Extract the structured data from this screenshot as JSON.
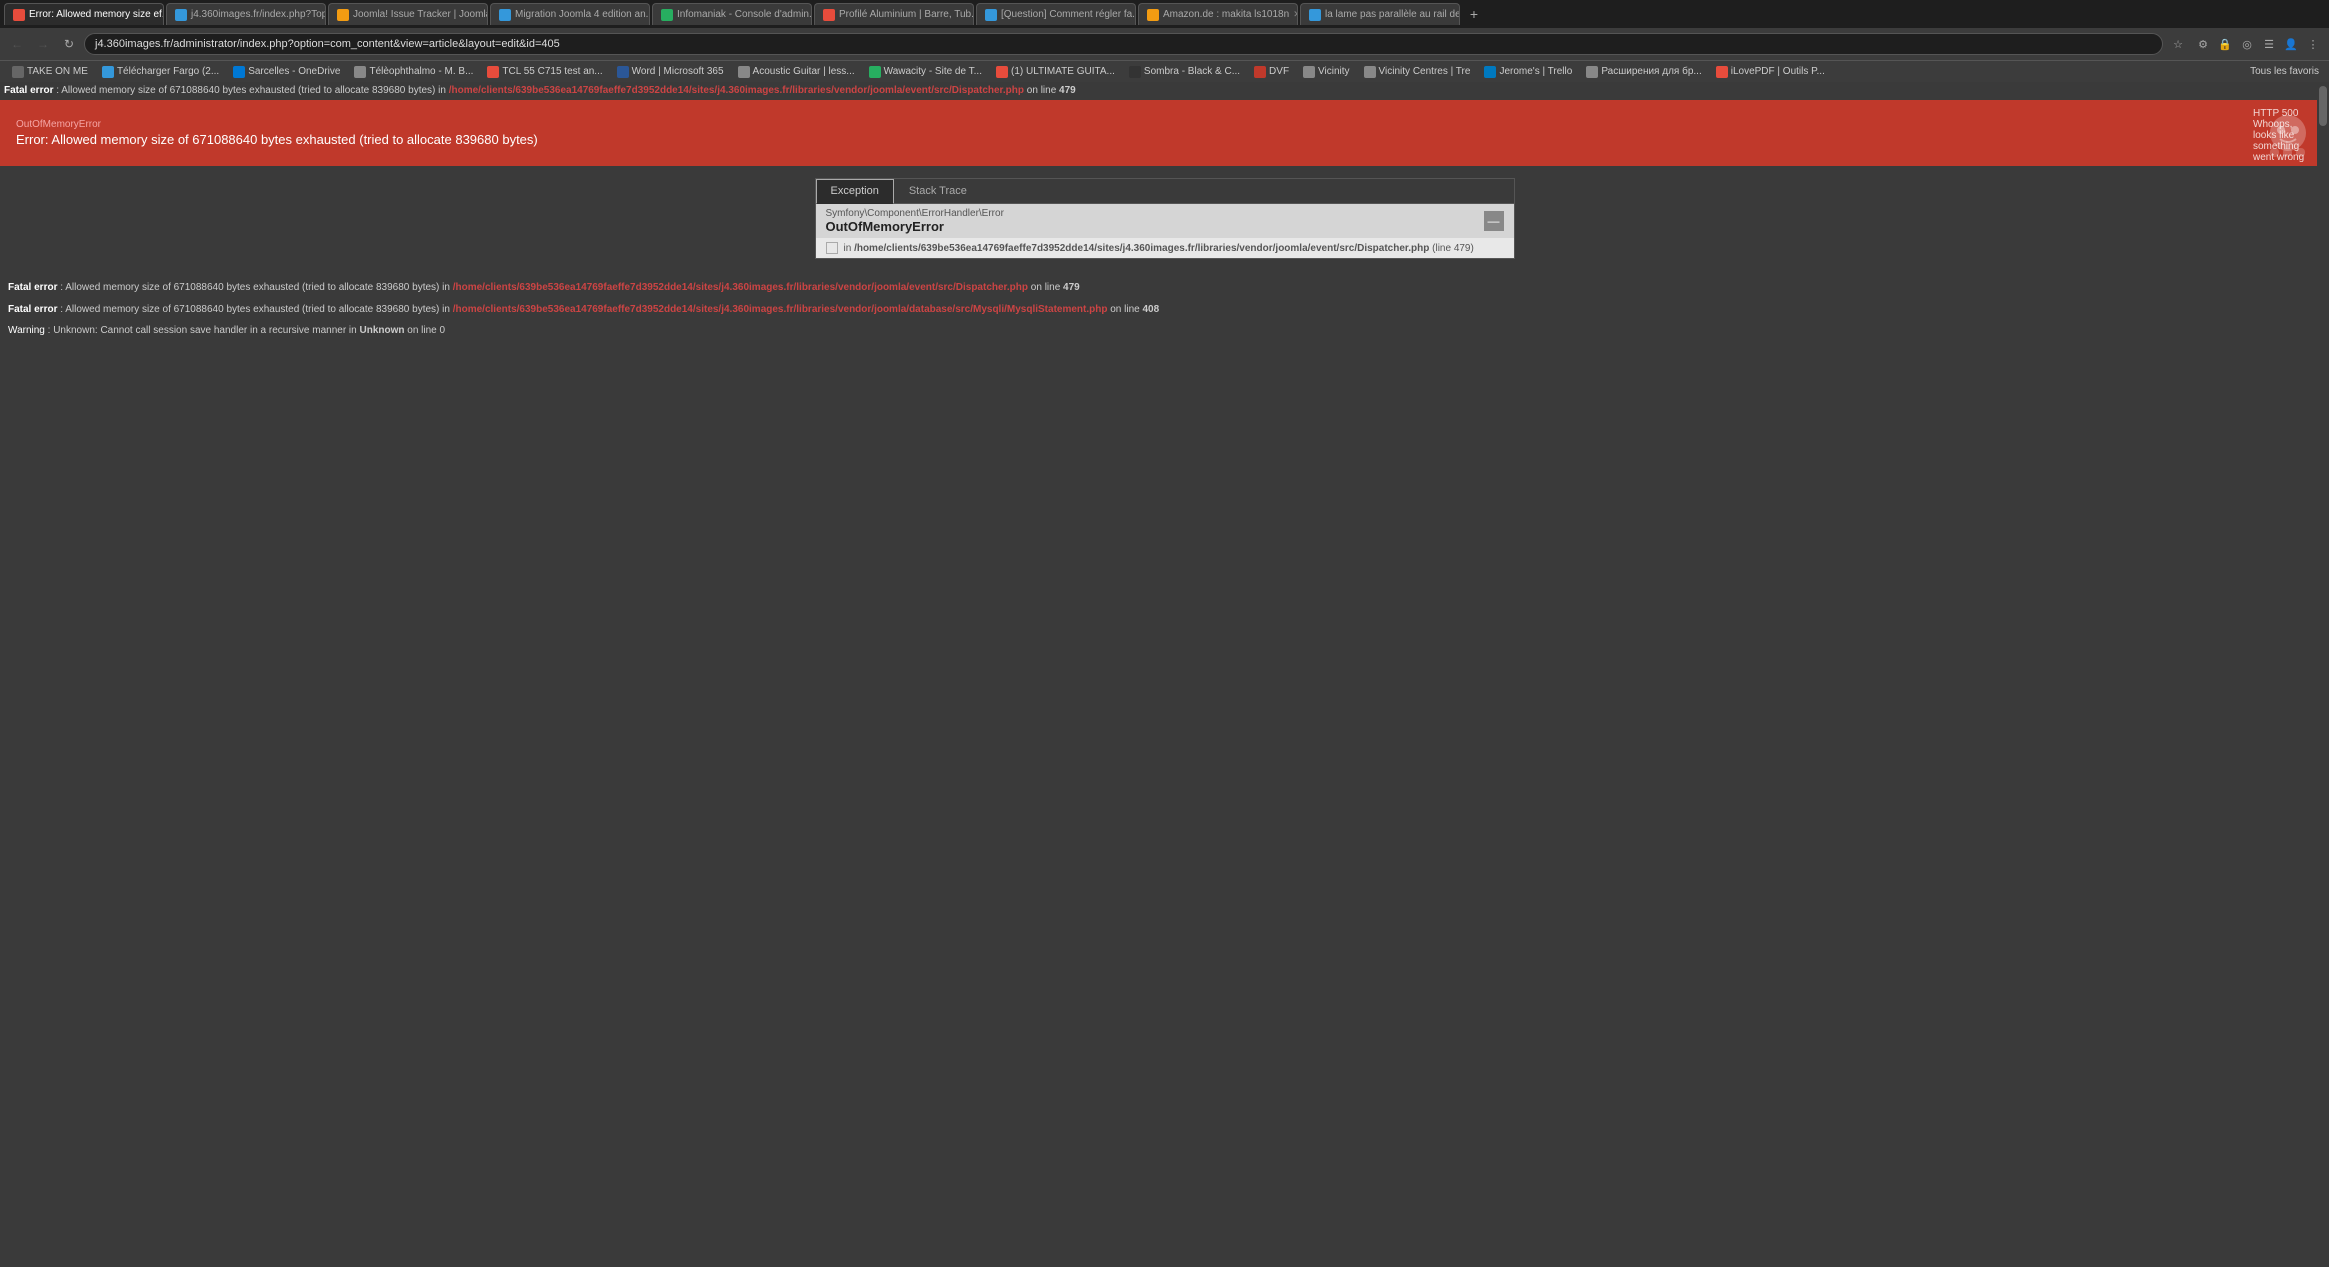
{
  "browser": {
    "tabs": [
      {
        "id": 1,
        "title": "Error: Allowed memory size ef...",
        "active": true,
        "favicon_color": "#e74c3c"
      },
      {
        "id": 2,
        "title": "j4.360images.fr/index.php?Top...",
        "active": false,
        "favicon_color": "#3498db"
      },
      {
        "id": 3,
        "title": "Joomla! Issue Tracker | Joomla...",
        "active": false,
        "favicon_color": "#f39c12"
      },
      {
        "id": 4,
        "title": "Migration Joomla 4 edition an...",
        "active": false,
        "favicon_color": "#3498db"
      },
      {
        "id": 5,
        "title": "Infomaniak - Console d'admin...",
        "active": false,
        "favicon_color": "#27ae60"
      },
      {
        "id": 6,
        "title": "Profilé Aluminium | Barre, Tub...",
        "active": false,
        "favicon_color": "#e74c3c"
      },
      {
        "id": 7,
        "title": "[Question] Comment régler fa...",
        "active": false,
        "favicon_color": "#3498db"
      },
      {
        "id": 8,
        "title": "Amazon.de : makita ls1018n",
        "active": false,
        "favicon_color": "#f39c12"
      },
      {
        "id": 9,
        "title": "la lame pas parallèle au rail de...",
        "active": false,
        "favicon_color": "#3498db"
      }
    ],
    "url": "j4.360images.fr/administrator/index.php?option=com_content&view=article&layout=edit&id=405",
    "bookmarks": [
      {
        "label": "TAKE ON ME"
      },
      {
        "label": "Télécharger Fargo (2..."
      },
      {
        "label": "Sarcelles - OneDrive"
      },
      {
        "label": "Télèophthalmo - M. B..."
      },
      {
        "label": "TCL 55 C715 test an..."
      },
      {
        "label": "Word | Microsoft 365"
      },
      {
        "label": "Acoustic Guitar | less..."
      },
      {
        "label": "Wawacity - Site de T..."
      },
      {
        "label": "(1) ULTIMATE GUITA..."
      },
      {
        "label": "Sombra - Black & C..."
      },
      {
        "label": "DVF"
      },
      {
        "label": "Vicinity"
      },
      {
        "label": "Vicinity Centres | Tre"
      },
      {
        "label": "Jerome's | Trello"
      },
      {
        "label": "Расширения для бр..."
      },
      {
        "label": "iLovePDF | Outils P..."
      },
      {
        "label": "Tous les favoris"
      }
    ]
  },
  "page": {
    "fatal_errors": [
      {
        "label": "Fatal error",
        "prefix": ": Allowed memory size of 671088640 bytes exhausted (tried to allocate 839680 bytes) in ",
        "path": "/home/clients/639be536ea14769faeffe7d3952dde14/sites/j4.360images.fr/libraries/vendor/joomla/event/src/Dispatcher.php",
        "suffix": " on line ",
        "line": "479"
      },
      {
        "label": "Fatal error",
        "prefix": ": Allowed memory size of 671088640 bytes exhausted (tried to allocate 839680 bytes) in ",
        "path": "/home/clients/639be536ea14769faeffe7d3952dde14/sites/j4.360images.fr/libraries/vendor/joomla/event/src/Dispatcher.php",
        "suffix": " on line ",
        "line": "479"
      },
      {
        "label": "Fatal error",
        "prefix": ": Allowed memory size of 671088640 bytes exhausted (tried to allocate 839680 bytes) in ",
        "path": "/home/clients/639be536ea14769faeffe7d3952dde14/sites/j4.360images.fr/libraries/vendor/joomla/database/src/Mysqli/MysqliStatement.php",
        "suffix": " on line ",
        "line": "408"
      }
    ],
    "warning": {
      "label": "Warning",
      "text": ": Unknown: Cannot call session save handler in a recursive manner in ",
      "path": "Unknown",
      "suffix": " on line ",
      "line": "0"
    },
    "banner": {
      "subtitle": "OutOfMemoryError",
      "whoops_text": "HTTP 500 Whoops, looks like something went wrong",
      "title": "Error: Allowed memory size of 671088640 bytes exhausted (tried to allocate 839680 bytes)"
    },
    "exception_tabs": [
      {
        "label": "Exception",
        "active": true
      },
      {
        "label": "Stack Trace",
        "active": false
      }
    ],
    "exception": {
      "type": "Symfony\\Component\\ErrorHandler\\Error",
      "name": "OutOfMemoryError",
      "file": "/home/clients/639be536ea14769faeffe7d3952dde14/sites/j4.360images.fr/libraries/vendor/joomla/event/src/Dispatcher.php",
      "file_line": "479"
    }
  }
}
